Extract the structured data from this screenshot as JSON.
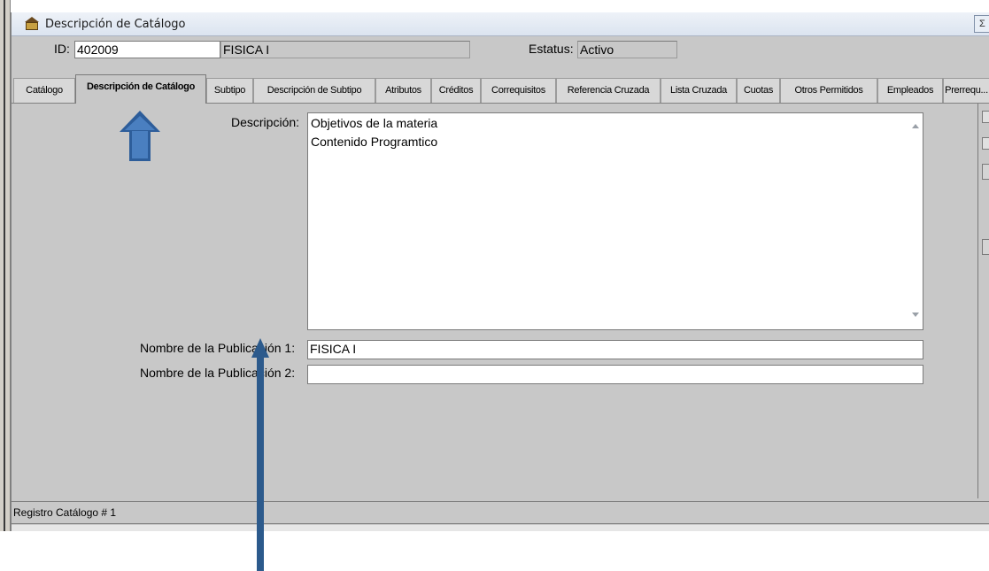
{
  "window": {
    "title": "Descripción de Catálogo",
    "title_button": "Σ"
  },
  "header": {
    "id_label": "ID:",
    "id_value": "402009",
    "course_name": "FISICA I",
    "status_label": "Estatus:",
    "status_value": "Activo"
  },
  "tabs": [
    {
      "label": "Catálogo"
    },
    {
      "label": "Descripción de Catálogo"
    },
    {
      "label": "Subtipo"
    },
    {
      "label": "Descripción de Subtipo"
    },
    {
      "label": "Atributos"
    },
    {
      "label": "Créditos"
    },
    {
      "label": "Correquisitos"
    },
    {
      "label": "Referencia Cruzada"
    },
    {
      "label": "Lista Cruzada"
    },
    {
      "label": "Cuotas"
    },
    {
      "label": "Otros Permitidos"
    },
    {
      "label": "Empleados"
    },
    {
      "label": "Prerrequ..."
    }
  ],
  "active_tab": "Descripción de Catálogo",
  "form": {
    "description_label": "Descripción:",
    "description_lines": [
      "Objetivos de la materia",
      "Contenido Programtico"
    ],
    "pub1_label": "Nombre de la Publicación 1:",
    "pub1_value": "FISICA I",
    "pub2_label": "Nombre de la Publicación 2:",
    "pub2_value": ""
  },
  "status_bar": {
    "text": "Registro Catálogo # 1"
  },
  "colors": {
    "annotation_arrow": "#2c5a8c",
    "window_bg": "#c8c8c8"
  },
  "icons": {
    "app": "catalog-building-icon"
  }
}
